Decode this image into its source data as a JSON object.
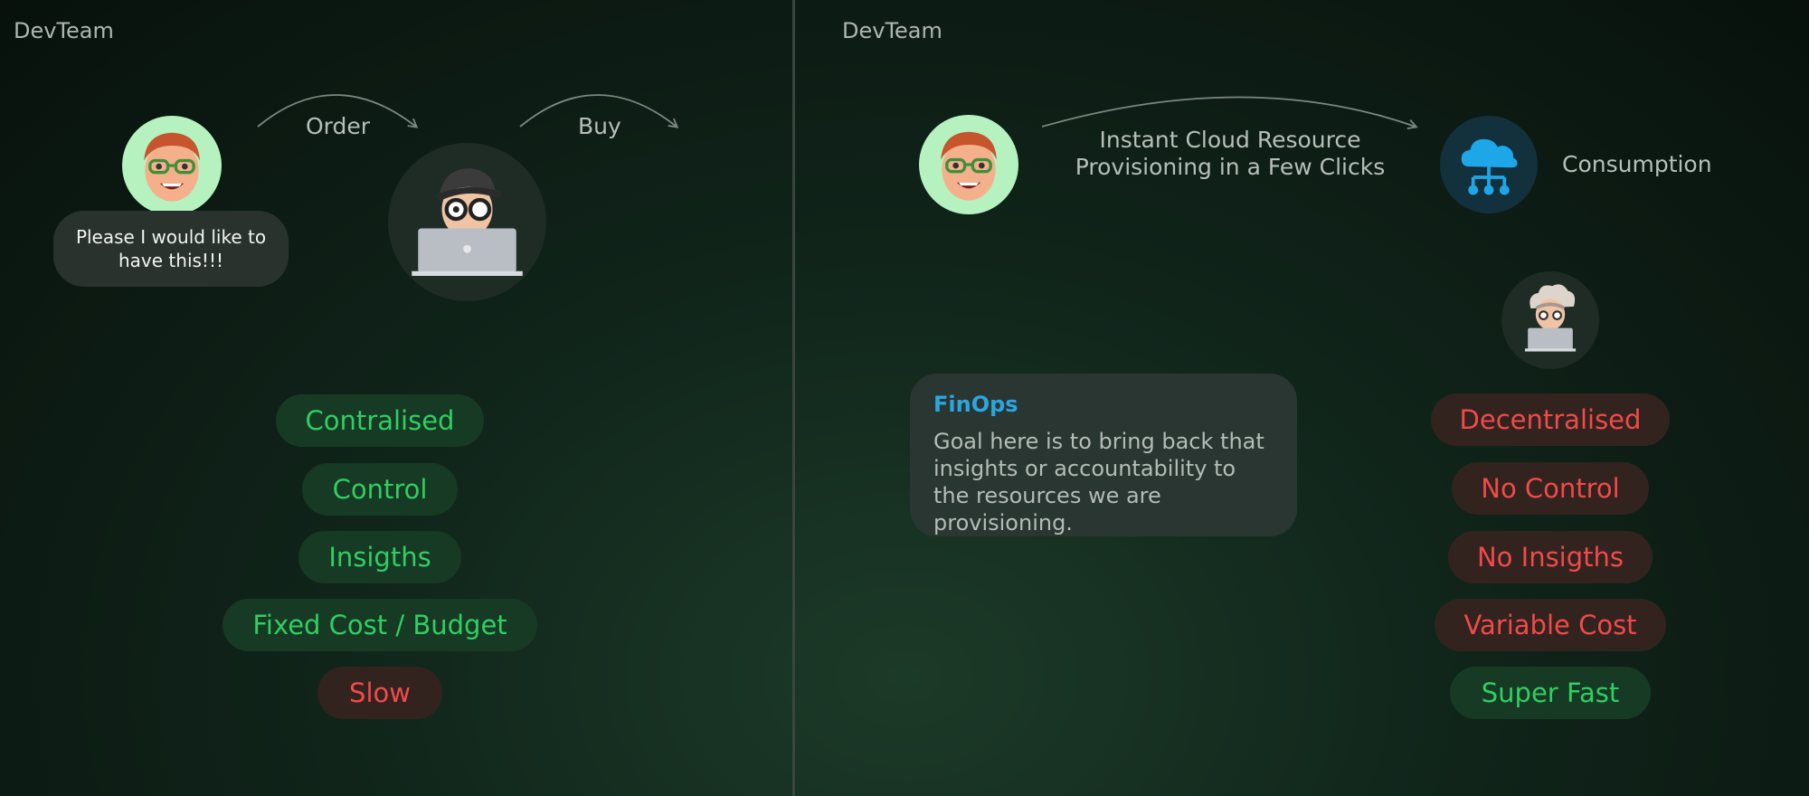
{
  "left": {
    "team_label": "DevTeam",
    "request_bubble": "Please I would like to have this!!!",
    "arrow_order": "Order",
    "arrow_buy": "Buy",
    "pills": [
      {
        "label": "Contralised",
        "tone": "good"
      },
      {
        "label": "Control",
        "tone": "good"
      },
      {
        "label": "Insigths",
        "tone": "good"
      },
      {
        "label": "Fixed Cost / Budget",
        "tone": "good"
      },
      {
        "label": "Slow",
        "tone": "bad"
      }
    ]
  },
  "right": {
    "team_label": "DevTeam",
    "provisioning_label": "Instant Cloud Resource Provisioning in a Few Clicks",
    "consumption_label": "Consumption",
    "card": {
      "title": "FinOps",
      "body": "Goal here is to bring back that insights or accountability to the resources we are provisioning."
    },
    "pills": [
      {
        "label": "Decentralised",
        "tone": "bad"
      },
      {
        "label": "No Control",
        "tone": "bad"
      },
      {
        "label": "No Insigths",
        "tone": "bad"
      },
      {
        "label": "Variable Cost",
        "tone": "bad"
      },
      {
        "label": "Super Fast",
        "tone": "good"
      }
    ]
  },
  "colors": {
    "good_text": "#2fcf62",
    "bad_text": "#f04a4a",
    "finops_title": "#2aa6e0",
    "cloud_icon": "#1ea7e8"
  },
  "icons": [
    "developer-avatar",
    "it-admin-avatar",
    "cloud-network-icon",
    "stressed-admin-avatar"
  ]
}
